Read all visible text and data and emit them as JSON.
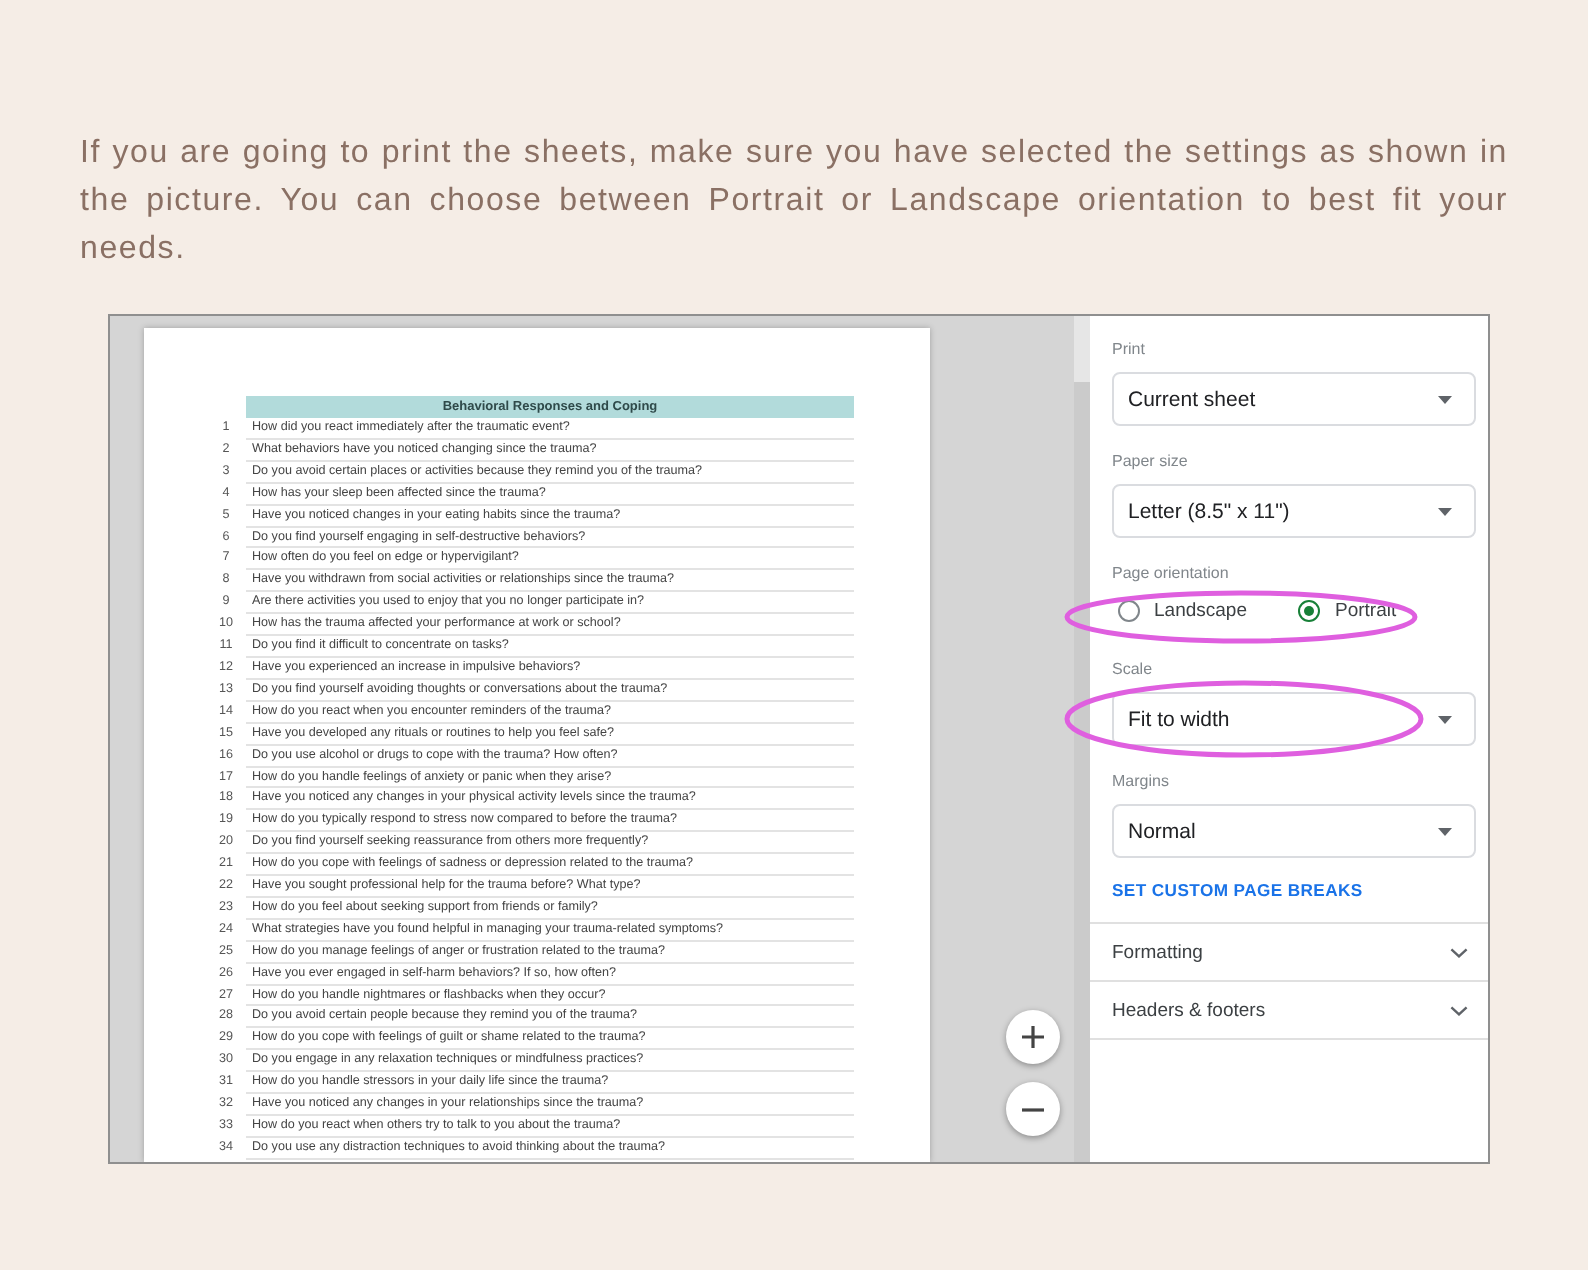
{
  "intro": "If you are going to print the sheets, make sure you have selected the settings as shown in the picture. You can choose between Portrait or Landscape orientation to best fit your needs.",
  "sheet": {
    "title": "Behavioral Responses and Coping",
    "rows": [
      {
        "number": "1",
        "question": "How did you react immediately after the traumatic event?"
      },
      {
        "number": "2",
        "question": "What behaviors have you noticed changing since the trauma?"
      },
      {
        "number": "3",
        "question": "Do you avoid certain places or activities because they remind you of the trauma?"
      },
      {
        "number": "4",
        "question": "How has your sleep been affected since the trauma?"
      },
      {
        "number": "5",
        "question": "Have you noticed changes in your eating habits since the trauma?"
      },
      {
        "number": "6",
        "question": "Do you find yourself engaging in self-destructive behaviors?"
      },
      {
        "number": "7",
        "question": "How often do you feel on edge or hypervigilant?"
      },
      {
        "number": "8",
        "question": "Have you withdrawn from social activities or relationships since the trauma?"
      },
      {
        "number": "9",
        "question": "Are there activities you used to enjoy that you no longer participate in?"
      },
      {
        "number": "10",
        "question": "How has the trauma affected your performance at work or school?"
      },
      {
        "number": "11",
        "question": "Do you find it difficult to concentrate on tasks?"
      },
      {
        "number": "12",
        "question": "Have you experienced an increase in impulsive behaviors?"
      },
      {
        "number": "13",
        "question": "Do you find yourself avoiding thoughts or conversations about the trauma?"
      },
      {
        "number": "14",
        "question": "How do you react when you encounter reminders of the trauma?"
      },
      {
        "number": "15",
        "question": "Have you developed any rituals or routines to help you feel safe?"
      },
      {
        "number": "16",
        "question": "Do you use alcohol or drugs to cope with the trauma? How often?"
      },
      {
        "number": "17",
        "question": "How do you handle feelings of anxiety or panic when they arise?"
      },
      {
        "number": "18",
        "question": "Have you noticed any changes in your physical activity levels since the trauma?"
      },
      {
        "number": "19",
        "question": "How do you typically respond to stress now compared to before the trauma?"
      },
      {
        "number": "20",
        "question": "Do you find yourself seeking reassurance from others more frequently?"
      },
      {
        "number": "21",
        "question": "How do you cope with feelings of sadness or depression related to the trauma?"
      },
      {
        "number": "22",
        "question": "Have you sought professional help for the trauma before? What type?"
      },
      {
        "number": "23",
        "question": "How do you feel about seeking support from friends or family?"
      },
      {
        "number": "24",
        "question": "What strategies have you found helpful in managing your trauma-related symptoms?"
      },
      {
        "number": "25",
        "question": "How do you manage feelings of anger or frustration related to the trauma?"
      },
      {
        "number": "26",
        "question": "Have you ever engaged in self-harm behaviors? If so, how often?"
      },
      {
        "number": "27",
        "question": "How do you handle nightmares or flashbacks when they occur?"
      },
      {
        "number": "28",
        "question": "Do you avoid certain people because they remind you of the trauma?"
      },
      {
        "number": "29",
        "question": "How do you cope with feelings of guilt or shame related to the trauma?"
      },
      {
        "number": "30",
        "question": "Do you engage in any relaxation techniques or mindfulness practices?"
      },
      {
        "number": "31",
        "question": "How do you handle stressors in your daily life since the trauma?"
      },
      {
        "number": "32",
        "question": "Have you noticed any changes in your relationships since the trauma?"
      },
      {
        "number": "33",
        "question": "How do you react when others try to talk to you about the trauma?"
      },
      {
        "number": "34",
        "question": "Do you use any distraction techniques to avoid thinking about the trauma?"
      }
    ]
  },
  "print_settings": {
    "settings": [
      {
        "kind": "select",
        "label": "Print",
        "value": "Current sheet",
        "highlighted": false
      },
      {
        "kind": "select",
        "label": "Paper size",
        "value": "Letter (8.5\" x 11\")",
        "highlighted": false
      },
      {
        "kind": "radio",
        "label": "Page orientation",
        "options": [
          {
            "label": "Landscape",
            "selected": false
          },
          {
            "label": "Portrait",
            "selected": true
          }
        ],
        "highlighted": true
      },
      {
        "kind": "select",
        "label": "Scale",
        "value": "Fit to width",
        "highlighted": true
      },
      {
        "kind": "select",
        "label": "Margins",
        "value": "Normal",
        "highlighted": false
      }
    ],
    "link": "SET CUSTOM PAGE BREAKS",
    "sections": [
      {
        "label": "Formatting",
        "expanded": false
      },
      {
        "label": "Headers & footers",
        "expanded": false
      }
    ]
  }
}
